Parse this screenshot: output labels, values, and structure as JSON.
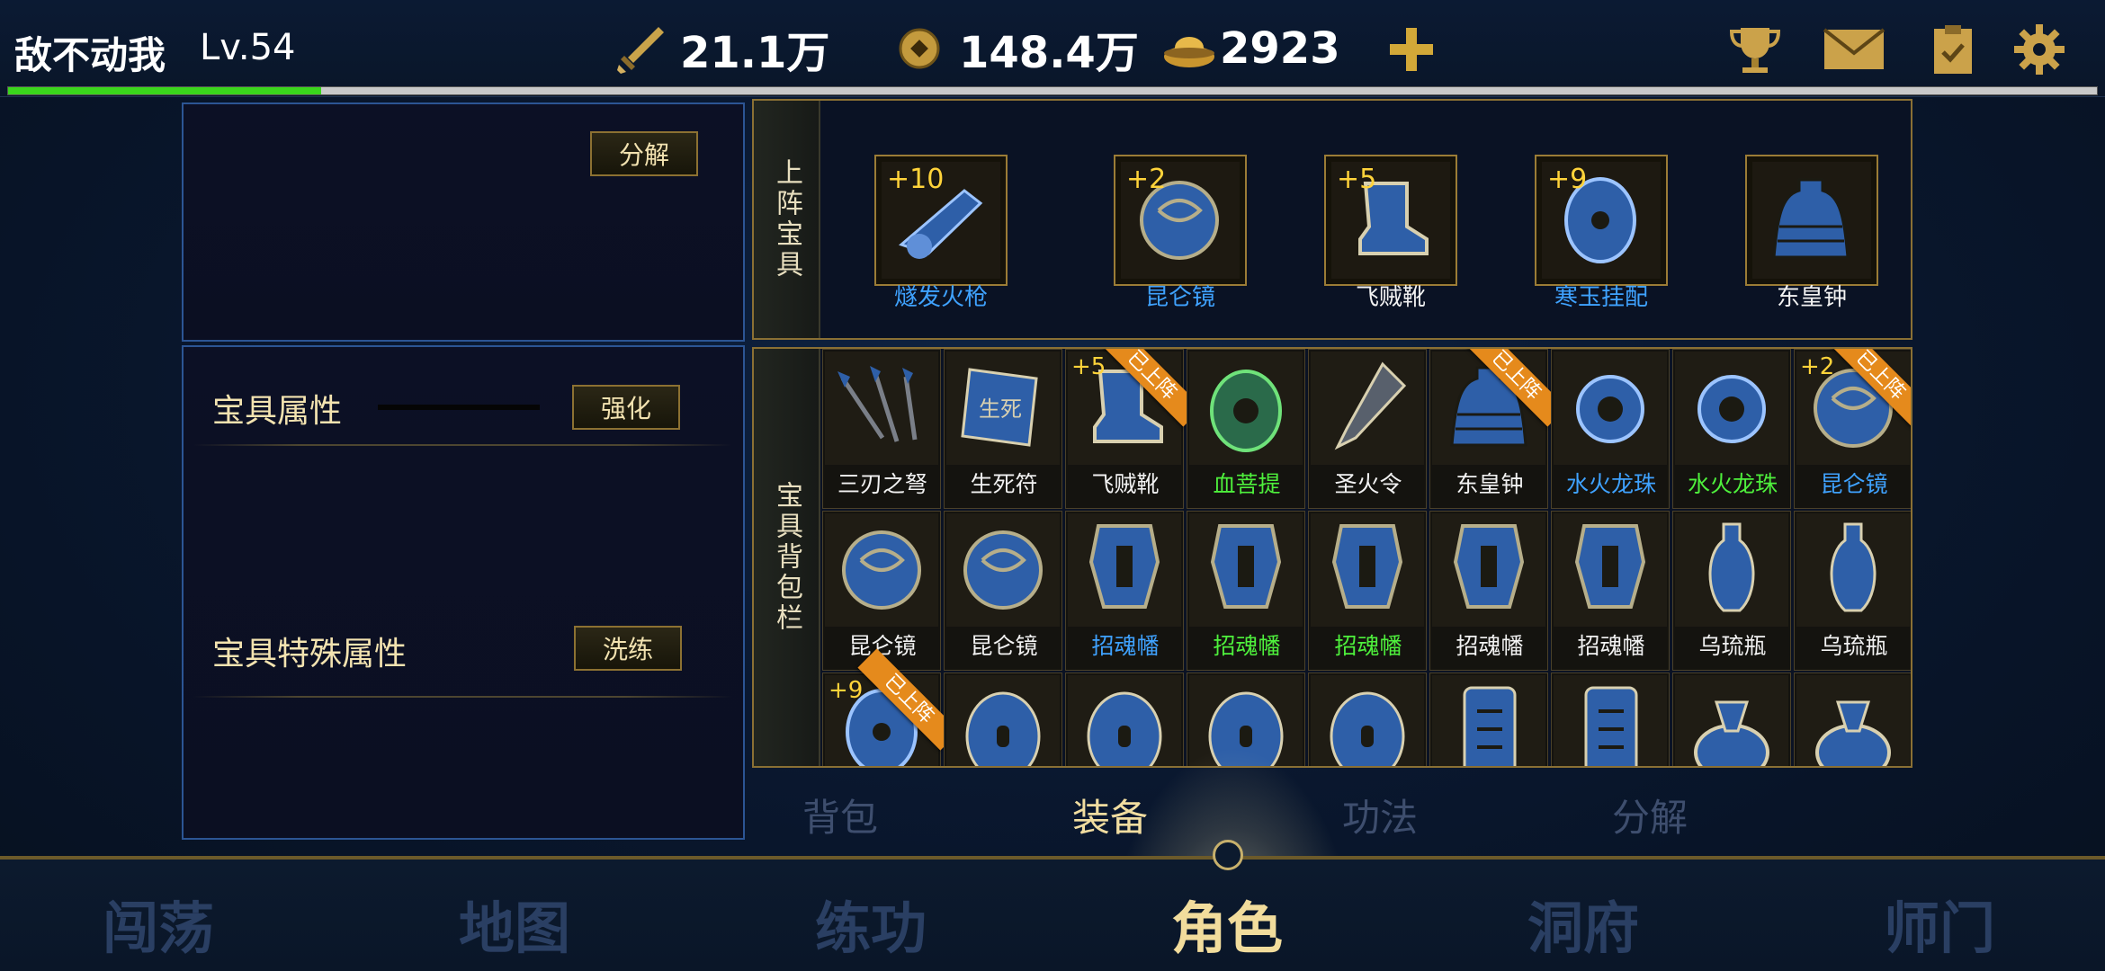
{
  "header": {
    "player_name": "敌不动我",
    "level": "Lv.54",
    "xp_progress": 0.15,
    "power": "21.1万",
    "coins": "148.4万",
    "ingots": "2923",
    "icons": [
      "sword-icon",
      "coin-icon",
      "ingot-icon",
      "plus-icon",
      "trophy-icon",
      "mail-icon",
      "clipboard-icon",
      "gear-icon"
    ]
  },
  "left_top": {
    "decompose_label": "分解"
  },
  "left_bottom": {
    "attr_title": "宝具属性",
    "enhance_label": "强化",
    "special_title": "宝具特殊属性",
    "refine_label": "洗练"
  },
  "equipped": {
    "label": "上阵宝具",
    "items": [
      {
        "name": "燧发火枪",
        "plus": "+10",
        "quality": "blue",
        "icon": "flintlock-icon"
      },
      {
        "name": "昆仑镜",
        "plus": "+2",
        "quality": "blue",
        "icon": "mirror-icon"
      },
      {
        "name": "飞贼靴",
        "plus": "+5",
        "quality": "white",
        "icon": "boot-icon"
      },
      {
        "name": "寒玉挂配",
        "plus": "+9",
        "quality": "blue",
        "icon": "jade-pendant-icon"
      },
      {
        "name": "东皇钟",
        "plus": "",
        "quality": "white",
        "icon": "bell-icon"
      }
    ]
  },
  "bag": {
    "label": "宝具背包栏",
    "rows": [
      [
        {
          "name": "三刃之弩",
          "quality": "white",
          "plus": "",
          "equipped": "",
          "icon": "crossbow-bolts-icon"
        },
        {
          "name": "生死符",
          "quality": "white",
          "plus": "",
          "equipped": "",
          "icon": "talisman-icon"
        },
        {
          "name": "飞贼靴",
          "quality": "white",
          "plus": "+5",
          "equipped": "已上阵",
          "icon": "boot-icon"
        },
        {
          "name": "血菩提",
          "quality": "green",
          "plus": "",
          "equipped": "",
          "icon": "bodhi-icon"
        },
        {
          "name": "圣火令",
          "quality": "white",
          "plus": "",
          "equipped": "",
          "icon": "token-icon"
        },
        {
          "name": "东皇钟",
          "quality": "white",
          "plus": "",
          "equipped": "已上阵",
          "icon": "bell-icon"
        },
        {
          "name": "水火龙珠",
          "quality": "blue",
          "plus": "",
          "equipped": "",
          "icon": "dragon-orb-icon"
        },
        {
          "name": "水火龙珠",
          "quality": "green",
          "plus": "",
          "equipped": "",
          "icon": "dragon-orb-icon"
        },
        {
          "name": "昆仑镜",
          "quality": "blue",
          "plus": "+2",
          "equipped": "已上阵",
          "icon": "mirror-icon"
        }
      ],
      [
        {
          "name": "昆仑镜",
          "quality": "white",
          "plus": "",
          "equipped": "",
          "icon": "mirror-icon"
        },
        {
          "name": "昆仑镜",
          "quality": "white",
          "plus": "",
          "equipped": "",
          "icon": "mirror-icon"
        },
        {
          "name": "招魂幡",
          "quality": "blue",
          "plus": "",
          "equipped": "",
          "icon": "banner-icon"
        },
        {
          "name": "招魂幡",
          "quality": "green",
          "plus": "",
          "equipped": "",
          "icon": "banner-icon"
        },
        {
          "name": "招魂幡",
          "quality": "green",
          "plus": "",
          "equipped": "",
          "icon": "banner-icon"
        },
        {
          "name": "招魂幡",
          "quality": "white",
          "plus": "",
          "equipped": "",
          "icon": "banner-icon"
        },
        {
          "name": "招魂幡",
          "quality": "white",
          "plus": "",
          "equipped": "",
          "icon": "banner-icon"
        },
        {
          "name": "乌琉瓶",
          "quality": "white",
          "plus": "",
          "equipped": "",
          "icon": "vase-icon"
        },
        {
          "name": "乌琉瓶",
          "quality": "white",
          "plus": "",
          "equipped": "",
          "icon": "vase-icon"
        }
      ],
      [
        {
          "name": "",
          "quality": "white",
          "plus": "+9",
          "equipped": "已上阵",
          "icon": "jade-pendant-icon"
        },
        {
          "name": "",
          "quality": "white",
          "plus": "",
          "equipped": "",
          "icon": "jade-disc-icon"
        },
        {
          "name": "",
          "quality": "white",
          "plus": "",
          "equipped": "",
          "icon": "jade-disc-icon"
        },
        {
          "name": "",
          "quality": "white",
          "plus": "",
          "equipped": "",
          "icon": "jade-disc-icon"
        },
        {
          "name": "",
          "quality": "white",
          "plus": "",
          "equipped": "",
          "icon": "jade-disc-icon"
        },
        {
          "name": "",
          "quality": "white",
          "plus": "",
          "equipped": "",
          "icon": "seal-tablet-icon"
        },
        {
          "name": "",
          "quality": "white",
          "plus": "",
          "equipped": "",
          "icon": "seal-tablet-icon"
        },
        {
          "name": "",
          "quality": "white",
          "plus": "",
          "equipped": "",
          "icon": "lamp-icon"
        },
        {
          "name": "",
          "quality": "white",
          "plus": "",
          "equipped": "",
          "icon": "lamp-icon"
        }
      ]
    ]
  },
  "sub_tabs": [
    {
      "label": "背包",
      "active": false
    },
    {
      "label": "装备",
      "active": true
    },
    {
      "label": "功法",
      "active": false
    },
    {
      "label": "分解",
      "active": false
    }
  ],
  "nav": [
    {
      "label": "闯荡",
      "active": false
    },
    {
      "label": "地图",
      "active": false
    },
    {
      "label": "练功",
      "active": false
    },
    {
      "label": "角色",
      "active": true
    },
    {
      "label": "洞府",
      "active": false
    },
    {
      "label": "师门",
      "active": false
    }
  ],
  "colors": {
    "quality_white": "#f2f2f2",
    "quality_blue": "#3fa2ff",
    "quality_green": "#4ef03c",
    "gold": "#f1dda0",
    "ribbon": "#e58a1c"
  }
}
